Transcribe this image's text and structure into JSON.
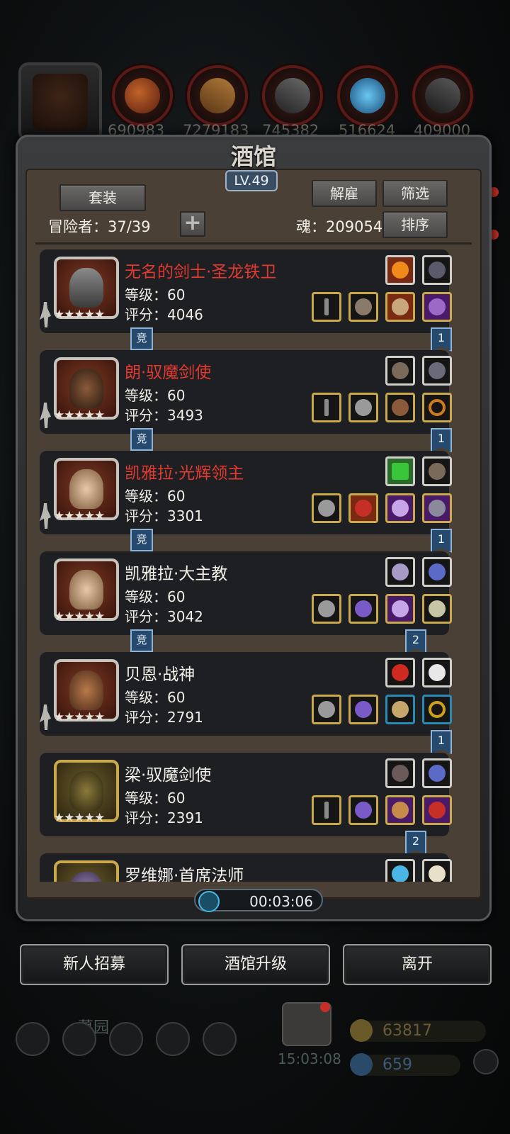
{
  "resources": {
    "values": [
      "690983",
      "7279183",
      "745382",
      "516624",
      "409000"
    ],
    "slot_icons": [
      "meat-icon",
      "wood-icon",
      "ore-icon",
      "crystal-icon",
      "iron-icon"
    ],
    "hero_slot_icon": "hooded-hero-icon"
  },
  "panel": {
    "title": "酒馆",
    "level": "LV.49",
    "set_button": "套装",
    "dismiss_button": "解雇",
    "filter_button": "筛选",
    "sort_button": "排序",
    "adventurer_label": "冒险者：",
    "adventurer_count": "37/39",
    "soul_label": "魂：",
    "soul_value": "209054",
    "timer": "00:03:06"
  },
  "heroes": [
    {
      "name": "无名的剑士·圣龙铁卫",
      "name_color": "red",
      "level": "等级：60",
      "score": "评分：4046",
      "stars": "★★★★★",
      "arena": "竞",
      "rank_badge": "1"
    },
    {
      "name": "朗·驭魔剑使",
      "name_color": "red",
      "level": "等级：60",
      "score": "评分：3493",
      "stars": "★★★★★",
      "arena": "竞",
      "rank_badge": "1"
    },
    {
      "name": "凯雅拉·光辉领主",
      "name_color": "red",
      "level": "等级：60",
      "score": "评分：3301",
      "stars": "★★★★★",
      "arena": "竞",
      "rank_badge": "1"
    },
    {
      "name": "凯雅拉·大主教",
      "name_color": "white",
      "level": "等级：60",
      "score": "评分：3042",
      "stars": "★★★★★",
      "arena": "竞",
      "rank_badge": "2"
    },
    {
      "name": "贝恩·战神",
      "name_color": "white",
      "level": "等级：60",
      "score": "评分：2791",
      "stars": "★★★★★",
      "arena": "",
      "rank_badge": "1"
    },
    {
      "name": "梁·驭魔剑使",
      "name_color": "white",
      "level": "等级：60",
      "score": "评分：2391",
      "stars": "★★★★★",
      "arena": "",
      "rank_badge": "2"
    },
    {
      "name": "罗维娜·首席法师",
      "name_color": "white",
      "level": "",
      "score": "",
      "stars": "",
      "arena": "",
      "rank_badge": ""
    }
  ],
  "bottom": {
    "recruit_button": "新人招募",
    "upgrade_button": "酒馆升级",
    "leave_button": "离开",
    "graveyard_label": "墓园",
    "gift_timer": "15:03:08",
    "gold": "63817",
    "gems": "659"
  },
  "colors": {
    "name_red": "#e23a30",
    "badge_blue": "#264a6e",
    "slot_gold": "#c9a94b",
    "slot_purple": "#4a1a6a"
  }
}
